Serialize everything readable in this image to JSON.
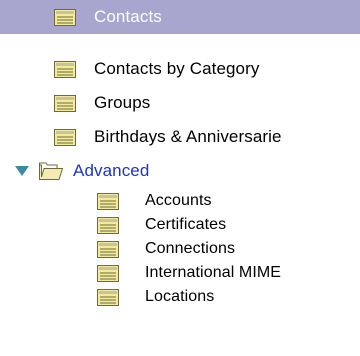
{
  "tree": {
    "items": [
      {
        "label": "Contacts",
        "icon": "view-icon",
        "selected": true
      },
      {
        "label": "Contacts by Category",
        "icon": "view-icon"
      },
      {
        "label": "Groups",
        "icon": "view-icon"
      },
      {
        "label": "Birthdays & Anniversarie",
        "icon": "view-icon"
      }
    ],
    "folder": {
      "label": "Advanced",
      "icon": "folder-icon",
      "expanded": true,
      "twisty": "expand-arrow-icon",
      "children": [
        {
          "label": "Accounts",
          "icon": "view-icon"
        },
        {
          "label": "Certificates",
          "icon": "view-icon"
        },
        {
          "label": "Connections",
          "icon": "view-icon"
        },
        {
          "label": "International MIME",
          "icon": "view-icon"
        },
        {
          "label": "Locations",
          "icon": "view-icon"
        }
      ]
    }
  },
  "colors": {
    "selection": "#a7a6cf",
    "folder_label": "#1b34c9",
    "twisty": "#3d8aa0",
    "view_icon_fill": "#f3ea9c",
    "view_icon_border": "#6e6a3a",
    "folder_fill": "#f4ebb2"
  }
}
